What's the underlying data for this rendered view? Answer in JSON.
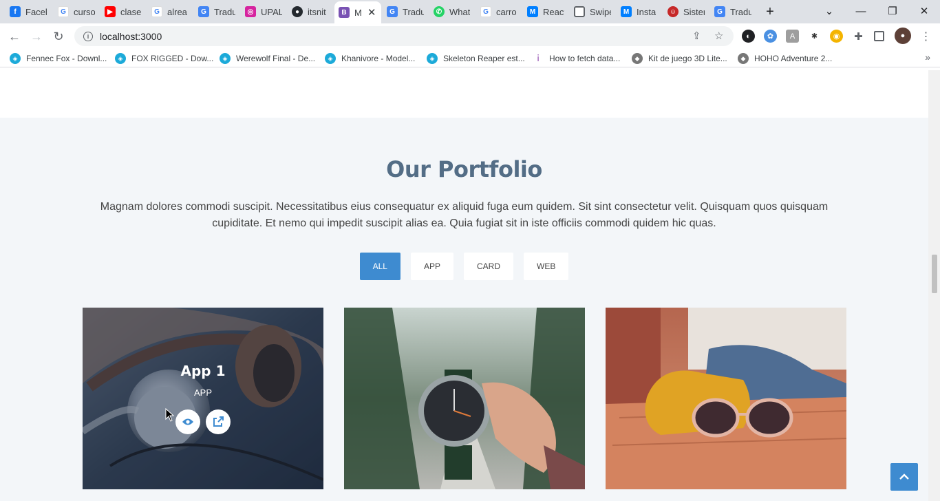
{
  "browser": {
    "tabs": [
      {
        "label": "Facel",
        "icon": "facebook-icon",
        "color": "#1877f2"
      },
      {
        "label": "curso",
        "icon": "google-icon",
        "color": "#4285f4"
      },
      {
        "label": "clase",
        "icon": "youtube-icon",
        "color": "#ff0000"
      },
      {
        "label": "alrea",
        "icon": "google-icon",
        "color": "#4285f4"
      },
      {
        "label": "Tradu",
        "icon": "translate-icon",
        "color": "#4285f4"
      },
      {
        "label": "UPAL",
        "icon": "instagram-icon",
        "color": "#d6249f"
      },
      {
        "label": "itsnit",
        "icon": "github-icon",
        "color": "#24292e"
      },
      {
        "label": "M",
        "icon": "bootstrap-icon",
        "color": "#7952b3"
      },
      {
        "label": "Tradu",
        "icon": "translate-icon",
        "color": "#4285f4"
      },
      {
        "label": "What",
        "icon": "whatsapp-icon",
        "color": "#25d366"
      },
      {
        "label": "carro",
        "icon": "google-icon",
        "color": "#4285f4"
      },
      {
        "label": "React",
        "icon": "mui-icon",
        "color": "#007fff"
      },
      {
        "label": "Swipe",
        "icon": "page-icon",
        "color": "#5f6368"
      },
      {
        "label": "Insta",
        "icon": "mui-icon",
        "color": "#007fff"
      },
      {
        "label": "Sister",
        "icon": "sister-icon",
        "color": "#c62828"
      },
      {
        "label": "Tradu",
        "icon": "translate-icon",
        "color": "#4285f4"
      }
    ],
    "active_tab_index": 7,
    "url": "localhost:3000",
    "bookmarks": [
      {
        "label": "Fennec Fox - Downl...",
        "icon": "sketchfab-icon",
        "color": "#1caad9"
      },
      {
        "label": "FOX RIGGED - Dow...",
        "icon": "sketchfab-icon",
        "color": "#1caad9"
      },
      {
        "label": "Werewolf Final - De...",
        "icon": "sketchfab-icon",
        "color": "#1caad9"
      },
      {
        "label": "Khanivore - Model...",
        "icon": "sketchfab-icon",
        "color": "#1caad9"
      },
      {
        "label": "Skeleton Reaper est...",
        "icon": "sketchfab-icon",
        "color": "#1caad9"
      },
      {
        "label": "How to fetch data...",
        "icon": "article-icon",
        "color": "#8e44ad"
      },
      {
        "label": "Kit de juego 3D Lite...",
        "icon": "unity-icon",
        "color": "#777777"
      },
      {
        "label": "HOHO Adventure 2...",
        "icon": "unity-icon",
        "color": "#777777"
      }
    ]
  },
  "portfolio": {
    "title": "Our Portfolio",
    "description": "Magnam dolores commodi suscipit. Necessitatibus eius consequatur ex aliquid fuga eum quidem. Sit sint consectetur velit. Quisquam quos quisquam cupiditate. Et nemo qui impedit suscipit alias ea. Quia fugiat sit in iste officiis commodi quidem hic quas.",
    "filters": [
      "ALL",
      "APP",
      "CARD",
      "WEB"
    ],
    "active_filter": "ALL",
    "items": [
      {
        "title": "App 1",
        "category": "APP",
        "image": "headphones",
        "hovered": true
      },
      {
        "image": "wristwatch"
      },
      {
        "image": "sunglasses"
      }
    ]
  },
  "colors": {
    "accent": "#3e8bd0",
    "title": "#536d86",
    "section_bg": "#f3f6f9"
  }
}
